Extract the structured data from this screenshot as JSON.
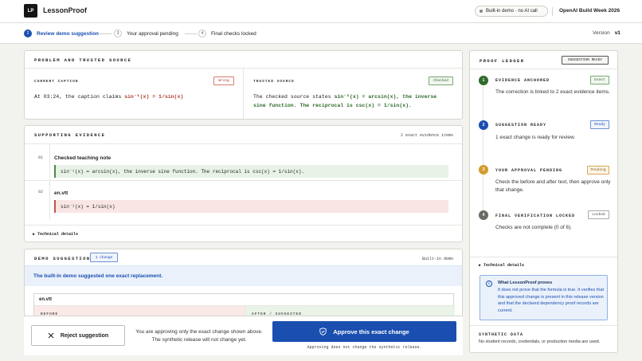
{
  "header": {
    "logo": "LP",
    "brand": "LessonProof",
    "demo_pill": "Built-in demo · no AI call",
    "event": "OpenAI Build Week 2026"
  },
  "steps": [
    {
      "n": "2",
      "label": "Review demo suggestion",
      "active": true
    },
    {
      "n": "3",
      "label": "Your approval pending",
      "active": false
    },
    {
      "n": "4",
      "label": "Final checks locked",
      "active": false
    }
  ],
  "version": {
    "label": "Version",
    "value": "v1"
  },
  "problem": {
    "title": "PROBLEM AND TRUSTED SOURCE",
    "current": {
      "label": "CURRENT CAPTION",
      "badge": "Wrong",
      "line_prefix": "At 03:24, the caption claims",
      "line_formula": "sin⁻¹(x) = 1/sin(x)"
    },
    "trusted": {
      "label": "TRUSTED SOURCE",
      "badge": "Checked",
      "line1_prefix": "The checked source states",
      "line1_formula": "sin⁻¹(x) = arcsin(x), the inverse",
      "line2_formula": "sine function. The reciprocal is csc(x) = 1/sin(x)."
    }
  },
  "evidence": {
    "title": "SUPPORTING EVIDENCE",
    "count": "2 exact evidence items",
    "items": [
      {
        "num": "01",
        "title": "Checked teaching note",
        "code": "sin⁻¹(x) = arcsin(x), the inverse sine function. The reciprocal is csc(x) = 1/sin(x)."
      },
      {
        "num": "02",
        "title": "en.vtt",
        "code": "sin⁻¹(x) = 1/sin(x)"
      }
    ],
    "tech": "Technical details"
  },
  "demo": {
    "title": "DEMO SUGGESTION",
    "badge": "1 change",
    "tag": "Built-in demo",
    "band": "The built-in demo suggested one exact replacement.",
    "file": "en.vtt",
    "before": "BEFORE",
    "after": "AFTER / SUGGESTED"
  },
  "actions": {
    "reject": "Reject suggestion",
    "note": "You are approving only the exact change shown above. The synthetic release will not change yet.",
    "approve": "Approve this exact change",
    "approve_note": "Approving does not change the synthetic release."
  },
  "ledger": {
    "title": "PROOF LEDGER",
    "badge": "SUGGESTION READY",
    "items": [
      {
        "n": "1",
        "title": "EVIDENCE ANCHORED",
        "badge": "Exact",
        "text": "The correction is linked to 2 exact evidence items."
      },
      {
        "n": "2",
        "title": "SUGGESTION READY",
        "badge": "Ready",
        "text": "1 exact change is ready for review."
      },
      {
        "n": "3",
        "title": "YOUR APPROVAL PENDING",
        "badge": "Pending",
        "text": "Check the before and after text, then approve only that change."
      },
      {
        "n": "4",
        "title": "FINAL VERIFICATION LOCKED",
        "badge": "Locked",
        "text": "Checks are not complete (0 of 6)."
      }
    ],
    "tech": "Technical details",
    "info_title": "What LessonProof proves",
    "info_body": "It does not prove that the formula is true. It verifies that this approved change is present in this release version and that the declared dependency proof records are current.",
    "synthetic_title": "SYNTHETIC DATA",
    "synthetic_body": "No student records, credentials, or production media are used."
  },
  "colors": {
    "accent": "#1a4fb0",
    "success": "#2f6a2b",
    "danger": "#b03a2e",
    "warning": "#d39b2f"
  }
}
